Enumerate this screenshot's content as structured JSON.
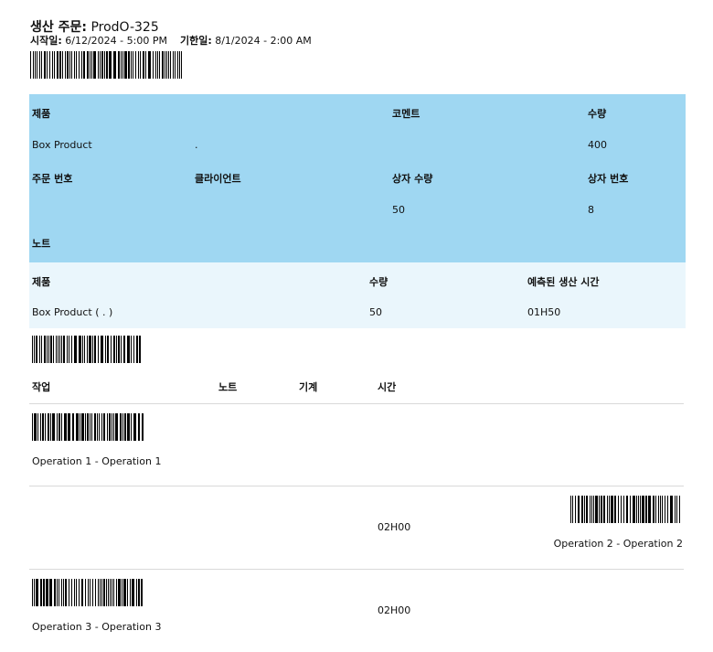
{
  "header": {
    "title_label": "생산 주문:",
    "order_id": "ProdO-325",
    "start_label": "시작일:",
    "start_value": "6/12/2024 - 5:00 PM",
    "due_label": "기한일:",
    "due_value": "8/1/2024 - 2:00 AM"
  },
  "info": {
    "product_label": "제품",
    "comment_label": "코멘트",
    "qty_label": "수량",
    "product_value": "Box Product",
    "product_variant": ".",
    "qty_value": "400",
    "order_no_label": "주문 번호",
    "client_label": "클라이언트",
    "box_qty_label": "상자 수량",
    "box_no_label": "상자 번호",
    "box_qty_value": "50",
    "box_no_value": "8",
    "notes_label": "노트"
  },
  "summary": {
    "product_label": "제품",
    "qty_label": "수량",
    "time_label": "예측된 생산 시간",
    "product_value": "Box Product ( . )",
    "qty_value": "50",
    "time_value": "01H50"
  },
  "ops_header": {
    "task": "작업",
    "notes": "노트",
    "machine": "기계",
    "time": "시간"
  },
  "operations": [
    {
      "name": "Operation 1 - Operation 1",
      "time": ""
    },
    {
      "name": "Operation 2 - Operation 2",
      "time": "02H00"
    },
    {
      "name": "Operation 3 - Operation 3",
      "time": "02H00"
    }
  ]
}
